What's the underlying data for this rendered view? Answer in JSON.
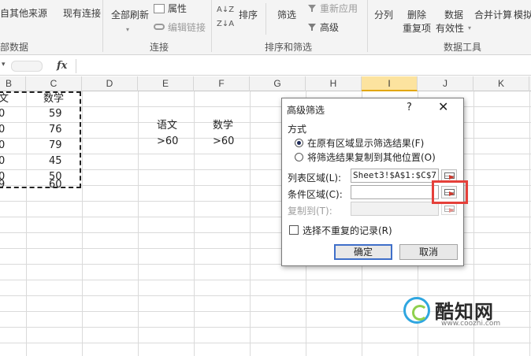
{
  "ribbon": {
    "row1": {
      "from_other_sources": "自其他来源",
      "existing_connections": "现有连接",
      "refresh_all": "全部刷新",
      "properties": "属性",
      "sort": "排序",
      "filter": "筛选",
      "reapply": "重新应用",
      "split_columns": "分列",
      "remove": "删除",
      "data": "数据",
      "consolidate": "合并计算",
      "whatif": "模拟"
    },
    "row2": {
      "edit_links": "编辑链接",
      "advanced": "高级",
      "duplicates": "重复项",
      "validity": "有效性"
    },
    "groups": {
      "get_external": "部数据",
      "connections": "连接",
      "sort_filter": "排序和筛选",
      "data_tools": "数据工具"
    },
    "az_label": "Z↓A",
    "sort_icon": "sort-za-icon"
  },
  "formula_bar": {
    "fx": "fx",
    "value": ""
  },
  "columns": [
    {
      "label": "B"
    },
    {
      "label": "C"
    },
    {
      "label": "D"
    },
    {
      "label": "E"
    },
    {
      "label": "F"
    },
    {
      "label": "G"
    },
    {
      "label": "H"
    },
    {
      "label": "I"
    },
    {
      "label": "J"
    },
    {
      "label": "K"
    }
  ],
  "selected_column": "I",
  "sheet": {
    "colB": [
      "文",
      "0",
      "0",
      "0",
      "0",
      "0",
      "9"
    ],
    "colC": [
      "数学",
      "59",
      "76",
      "79",
      "45",
      "50",
      "60"
    ],
    "criteria_header": [
      "语文",
      "数学"
    ],
    "criteria_values": [
      ">60",
      ">60"
    ]
  },
  "dialog": {
    "title": "高级筛选",
    "help": "?",
    "close": "✕",
    "mode_label": "方式",
    "option_in_place": "在原有区域显示筛选结果(F)",
    "option_copy": "将筛选结果复制到其他位置(O)",
    "list_range_label": "列表区域(L):",
    "list_range_value": "Sheet3!$A$1:$C$7",
    "criteria_range_label": "条件区域(C):",
    "criteria_range_value": "",
    "copy_to_label": "复制到(T):",
    "copy_to_value": "",
    "unique_label": "选择不重复的记录(R)",
    "ok": "确定",
    "cancel": "取消"
  },
  "watermark": {
    "name": "酷知网",
    "url": "www.coozhi.com"
  },
  "colors": {
    "selected_col_bg": "#fce39f",
    "highlight_box": "#e5403a",
    "ok_border": "#3f6fc9"
  }
}
